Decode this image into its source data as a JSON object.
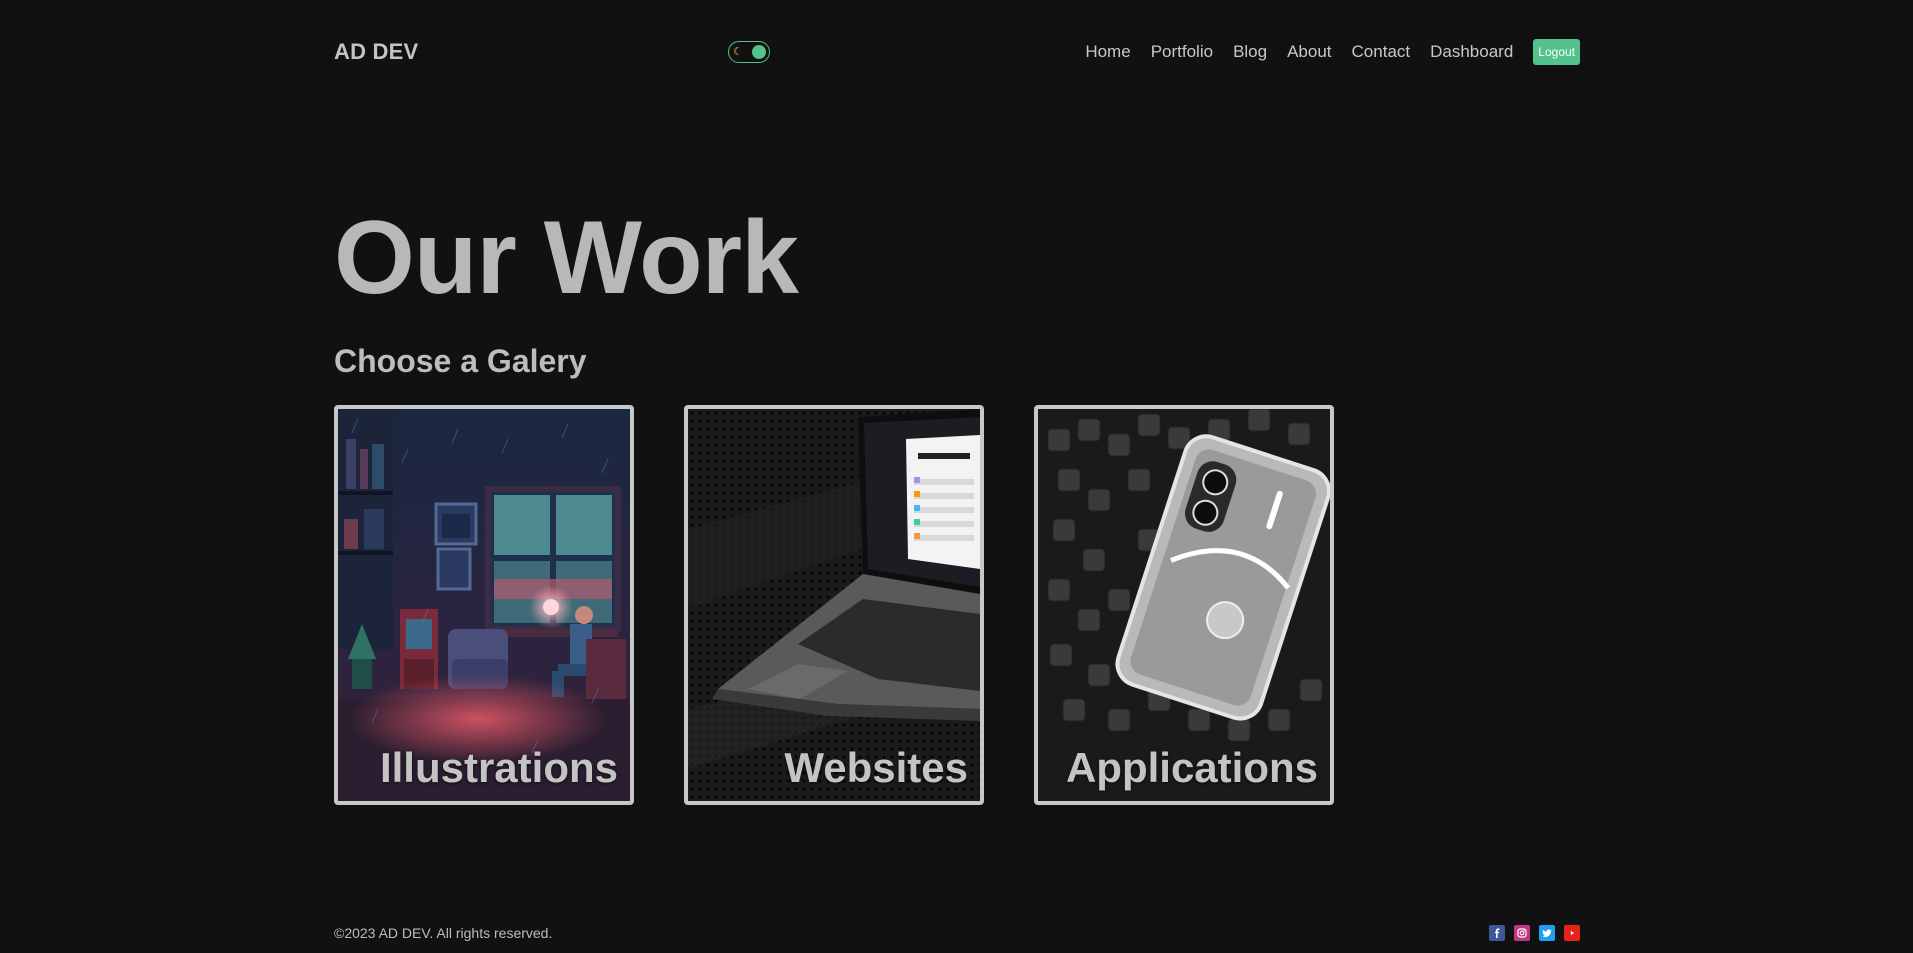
{
  "navbar": {
    "logo": "AD DEV",
    "theme_toggle_icon": "moon-icon",
    "links": [
      {
        "label": "Home"
      },
      {
        "label": "Portfolio"
      },
      {
        "label": "Blog"
      },
      {
        "label": "About"
      },
      {
        "label": "Contact"
      },
      {
        "label": "Dashboard"
      }
    ],
    "logout_label": "Logout"
  },
  "hero": {
    "title": "Our Work",
    "subtitle": "Choose a Galery"
  },
  "gallery": [
    {
      "label": "Illustrations",
      "image": "pixel-art-room-illustration"
    },
    {
      "label": "Websites",
      "image": "laptop-on-perforated-metal"
    },
    {
      "label": "Applications",
      "image": "transparent-phone-on-foam"
    }
  ],
  "footer": {
    "copyright": "©2023 AD DEV. All rights reserved.",
    "socials": [
      {
        "icon": "facebook-icon",
        "color": "#3b5998"
      },
      {
        "icon": "instagram-icon",
        "color": "#c13584"
      },
      {
        "icon": "twitter-icon",
        "color": "#1da1f2"
      },
      {
        "icon": "youtube-icon",
        "color": "#e62117"
      }
    ]
  },
  "colors": {
    "background": "#111111",
    "accent": "#53c28b",
    "text": "#bbbbbb",
    "card_border": "#c8c8c8"
  }
}
